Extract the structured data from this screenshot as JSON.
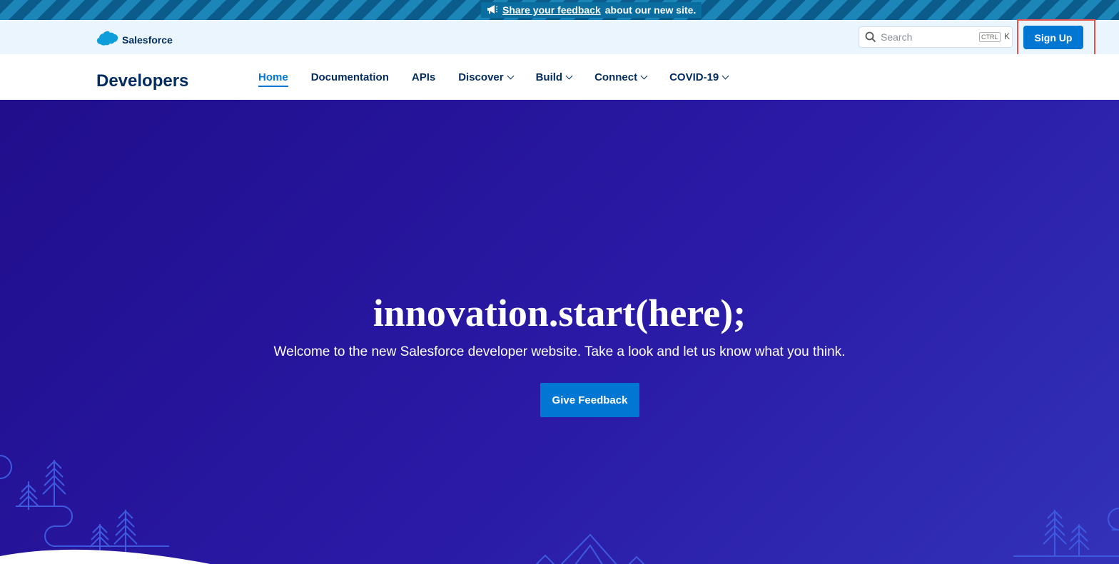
{
  "banner": {
    "link_text": "Share your feedback",
    "rest_text": "about our new site.",
    "icon": "megaphone-icon"
  },
  "topbar": {
    "brand_name": "Salesforce",
    "search_placeholder": "Search",
    "shortcut_key1": "CTRL",
    "shortcut_key2": "K",
    "signup_label": "Sign Up"
  },
  "nav": {
    "site_title": "Developers",
    "items": [
      {
        "label": "Home",
        "active": true
      },
      {
        "label": "Documentation"
      },
      {
        "label": "APIs"
      },
      {
        "label": "Discover",
        "dropdown": true
      },
      {
        "label": "Build",
        "dropdown": true
      },
      {
        "label": "Connect",
        "dropdown": true
      },
      {
        "label": "COVID-19",
        "dropdown": true
      }
    ]
  },
  "hero": {
    "title": "innovation.start(here);",
    "subtitle": "Welcome to the new Salesforce developer website. Take a look and let us know what you think.",
    "cta_label": "Give Feedback"
  },
  "colors": {
    "brand_blue": "#0176d3",
    "navy": "#032d60",
    "hero_start": "#200e8c",
    "hero_end": "#3232b8",
    "annotation_red": "#e8534b"
  }
}
